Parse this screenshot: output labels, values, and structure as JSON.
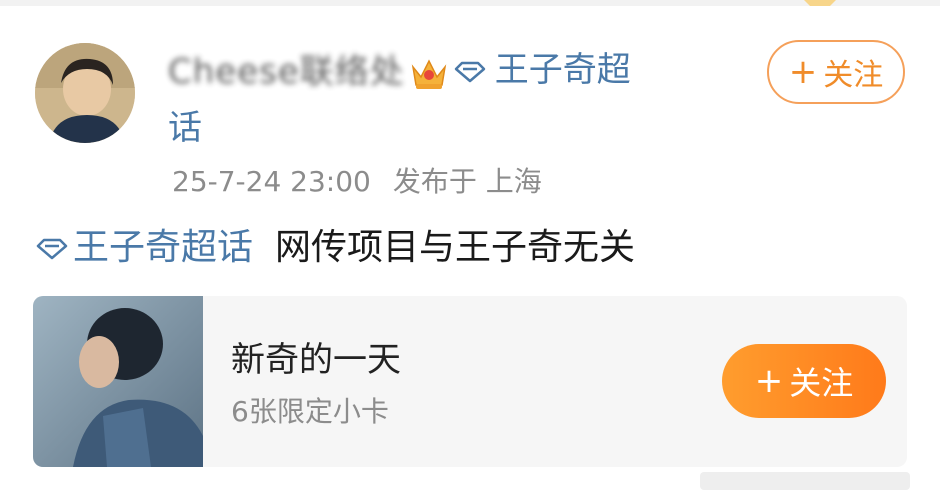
{
  "post": {
    "author": {
      "name_blurred": "Cheese联络处",
      "avatar_icon": "avatar-photo"
    },
    "topic_tag": "王子奇超话",
    "topic_wrap": "话",
    "topic_tag_head": "王子奇超",
    "timestamp": "25-7-24 23:00",
    "location": "发布于 上海",
    "text": "网传项目与王子奇无关",
    "follow_button": {
      "plus": "+",
      "label": "关注"
    }
  },
  "card": {
    "title": "新奇的一天",
    "subtitle": "6张限定小卡",
    "follow_button": {
      "plus": "+",
      "label": "关注"
    }
  },
  "colors": {
    "accent_orange": "#f08c2a",
    "topic_blue": "#4a79a8",
    "meta_gray": "#8c8c8c"
  }
}
